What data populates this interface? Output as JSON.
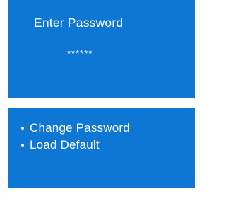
{
  "password_panel": {
    "title": "Enter Password",
    "masked_value": "******"
  },
  "menu_panel": {
    "items": [
      {
        "label": "Change Password",
        "icon": "bullet-icon"
      },
      {
        "label": "Load Default",
        "icon": "bullet-icon"
      }
    ]
  },
  "colors": {
    "screen_background": "#0e77d4",
    "text": "#ffffff",
    "page_background": "#ffffff"
  }
}
